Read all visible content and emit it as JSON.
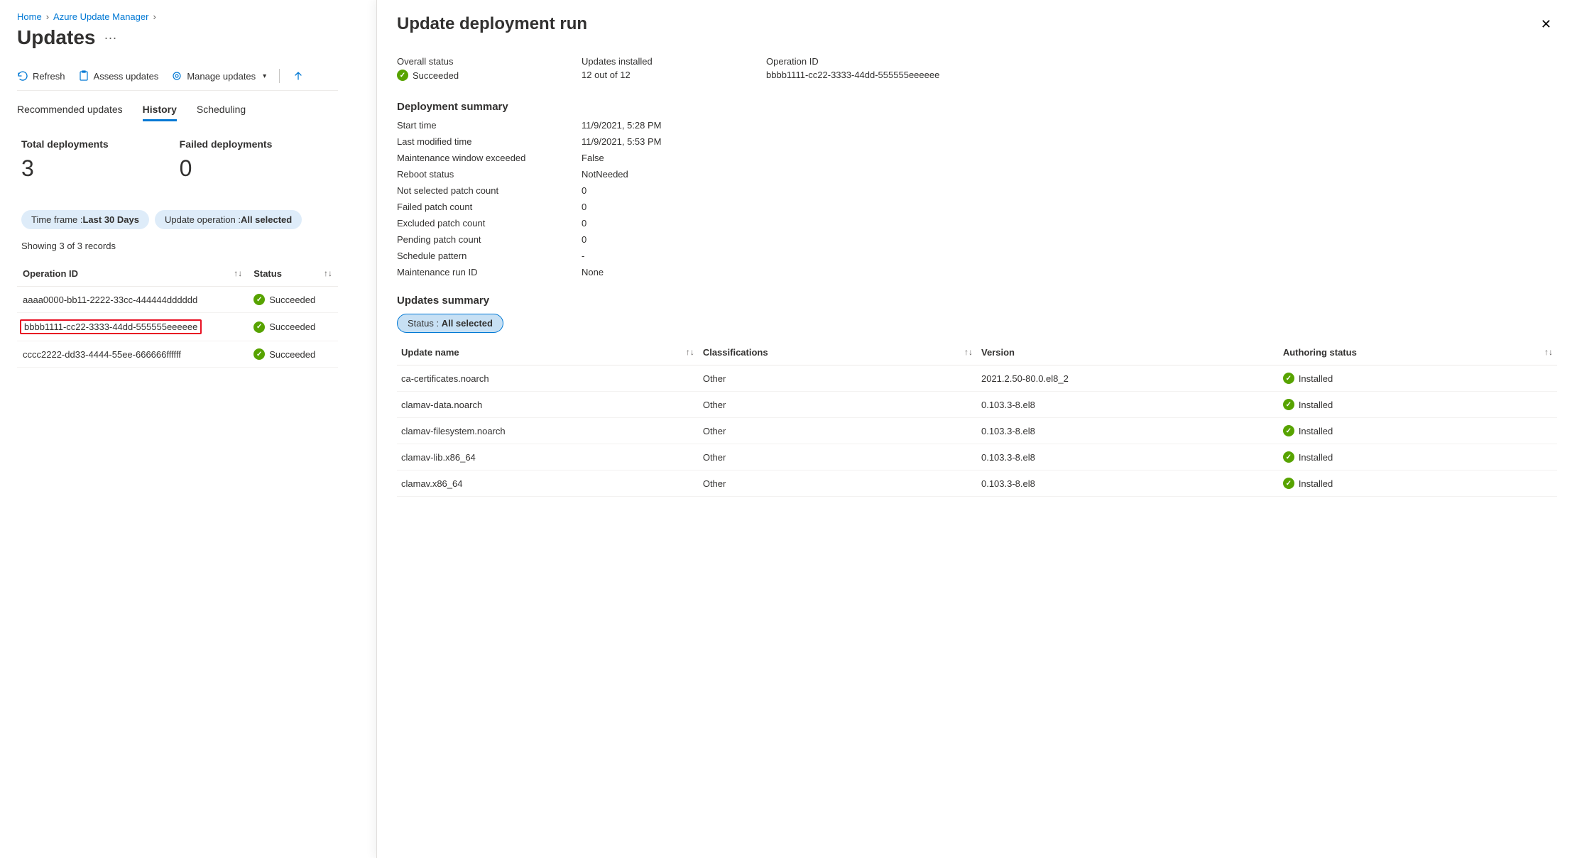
{
  "breadcrumb": {
    "home": "Home",
    "service": "Azure Update Manager"
  },
  "page": {
    "title": "Updates",
    "more": "···"
  },
  "toolbar": {
    "refresh": "Refresh",
    "assess": "Assess updates",
    "manage": "Manage updates"
  },
  "tabs": {
    "recommended": "Recommended updates",
    "history": "History",
    "scheduling": "Scheduling"
  },
  "stats": {
    "total_label": "Total deployments",
    "total_value": "3",
    "failed_label": "Failed deployments",
    "failed_value": "0"
  },
  "filters": {
    "timeframe_label": "Time frame : ",
    "timeframe_value": "Last 30 Days",
    "operation_label": "Update operation : ",
    "operation_value": "All selected"
  },
  "records_info": "Showing 3 of 3 records",
  "history_table": {
    "col_operation": "Operation ID",
    "col_status": "Status",
    "rows": [
      {
        "id": "aaaa0000-bb11-2222-33cc-444444dddddd",
        "status": "Succeeded",
        "highlight": false
      },
      {
        "id": "bbbb1111-cc22-3333-44dd-555555eeeeee",
        "status": "Succeeded",
        "highlight": true
      },
      {
        "id": "cccc2222-dd33-4444-55ee-666666ffffff",
        "status": "Succeeded",
        "highlight": false
      }
    ]
  },
  "panel": {
    "title": "Update deployment run",
    "overview": {
      "overall_status_label": "Overall status",
      "overall_status_value": "Succeeded",
      "updates_installed_label": "Updates installed",
      "updates_installed_value": "12 out of 12",
      "operation_id_label": "Operation ID",
      "operation_id_value": "bbbb1111-cc22-3333-44dd-555555eeeeee"
    },
    "deployment_summary_title": "Deployment summary",
    "summary": {
      "start_time_label": "Start time",
      "start_time_value": "11/9/2021, 5:28 PM",
      "last_modified_label": "Last modified time",
      "last_modified_value": "11/9/2021, 5:53 PM",
      "maint_window_label": "Maintenance window exceeded",
      "maint_window_value": "False",
      "reboot_label": "Reboot status",
      "reboot_value": "NotNeeded",
      "not_selected_label": "Not selected patch count",
      "not_selected_value": "0",
      "failed_patch_label": "Failed patch count",
      "failed_patch_value": "0",
      "excluded_label": "Excluded patch count",
      "excluded_value": "0",
      "pending_label": "Pending patch count",
      "pending_value": "0",
      "schedule_label": "Schedule pattern",
      "schedule_value": "-",
      "maint_run_label": "Maintenance run ID",
      "maint_run_value": "None"
    },
    "updates_summary_title": "Updates summary",
    "updates_filter_label": "Status : ",
    "updates_filter_value": "All selected",
    "updates_table": {
      "col_name": "Update name",
      "col_class": "Classifications",
      "col_version": "Version",
      "col_auth": "Authoring status",
      "rows": [
        {
          "name": "ca-certificates.noarch",
          "class": "Other",
          "version": "2021.2.50-80.0.el8_2",
          "status": "Installed"
        },
        {
          "name": "clamav-data.noarch",
          "class": "Other",
          "version": "0.103.3-8.el8",
          "status": "Installed"
        },
        {
          "name": "clamav-filesystem.noarch",
          "class": "Other",
          "version": "0.103.3-8.el8",
          "status": "Installed"
        },
        {
          "name": "clamav-lib.x86_64",
          "class": "Other",
          "version": "0.103.3-8.el8",
          "status": "Installed"
        },
        {
          "name": "clamav.x86_64",
          "class": "Other",
          "version": "0.103.3-8.el8",
          "status": "Installed"
        }
      ]
    }
  }
}
